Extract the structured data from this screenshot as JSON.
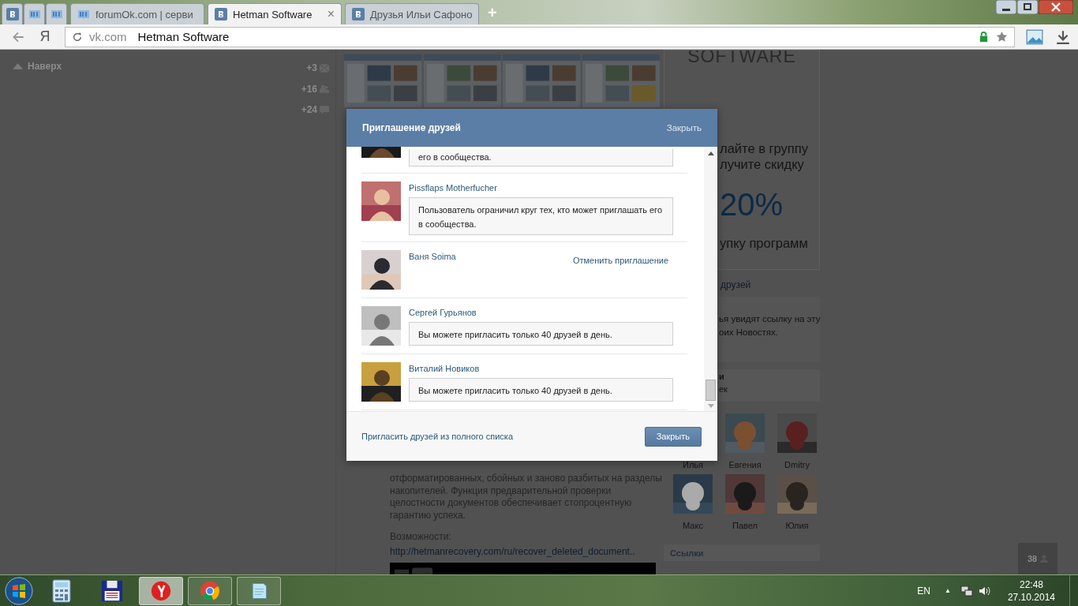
{
  "browser": {
    "tabs": [
      {
        "kind": "vk",
        "selected": false
      },
      {
        "kind": "book",
        "selected": false
      },
      {
        "kind": "book",
        "selected": false
      },
      {
        "kind": "book",
        "label": "forumOk.com | серви",
        "selected": false
      },
      {
        "kind": "vk",
        "label": "Hetman Software",
        "selected": true
      },
      {
        "kind": "vk",
        "label": "Друзья Ильи Сафоно",
        "selected": false
      }
    ],
    "new_tab": "+",
    "close_tab": "×",
    "logo": "Я",
    "address": {
      "host": "vk.com",
      "title": "Hetman Software"
    }
  },
  "left": {
    "back_to_top": "Наверх",
    "counters": [
      {
        "count": "+3",
        "kind": "mail"
      },
      {
        "count": "+16",
        "kind": "people"
      },
      {
        "count": "+24",
        "kind": "comment"
      }
    ]
  },
  "post": {
    "lines": [
      "отформатированных, сбойных и заново разбитых на разделы",
      "накопителей. Функция предварительной проверки",
      "целостности документов обеспечивает стопроцентную",
      "гарантию успеха."
    ],
    "features_label": "Возможности:",
    "link": "http://hetmanrecovery.com/ru/recover_deleted_document.."
  },
  "right": {
    "ad": {
      "brand": "SOFTWARE",
      "lines": [
        "лайте в группу",
        "лучите скидку"
      ],
      "discount": "20%",
      "tail": "упку программ"
    },
    "invite_link": "друзей",
    "invite_note": [
      "ья увидят ссылку на эту",
      "оих Новостях."
    ],
    "friends_header": "и",
    "friends_sub": "ек",
    "friends": [
      {
        "name": "Илья",
        "photo": false
      },
      {
        "name": "Евгения",
        "photo": true
      },
      {
        "name": "Dmitry",
        "photo": true
      },
      {
        "name": "Макс",
        "photo": true
      },
      {
        "name": "Павел",
        "photo": true
      },
      {
        "name": "Юлия",
        "photo": true
      }
    ],
    "links_header": "Ссылки"
  },
  "chat_badge": "38",
  "modal": {
    "title": "Приглашение друзей",
    "close_link": "Закрыть",
    "items": [
      {
        "kind": "partial",
        "message": "его в сообщества."
      },
      {
        "kind": "message",
        "name": "Pissflaps Motherfucher",
        "message": "Пользователь ограничил круг тех, кто может приглашать его в сообщества."
      },
      {
        "kind": "invited",
        "name": "Ваня Soima",
        "action": "Отменить приглашение"
      },
      {
        "kind": "message",
        "name": "Сергей Гурьянов",
        "message": "Вы можете пригласить только 40 друзей в день."
      },
      {
        "kind": "message",
        "name": "Виталий Новиков",
        "message": "Вы можете пригласить только 40 друзей в день."
      }
    ],
    "footer_link": "Пригласить друзей из полного списка",
    "close_button": "Закрыть"
  },
  "taskbar": {
    "language": "EN",
    "tray_arrow": "▲",
    "time": "22:48",
    "date": "27.10.2014"
  }
}
